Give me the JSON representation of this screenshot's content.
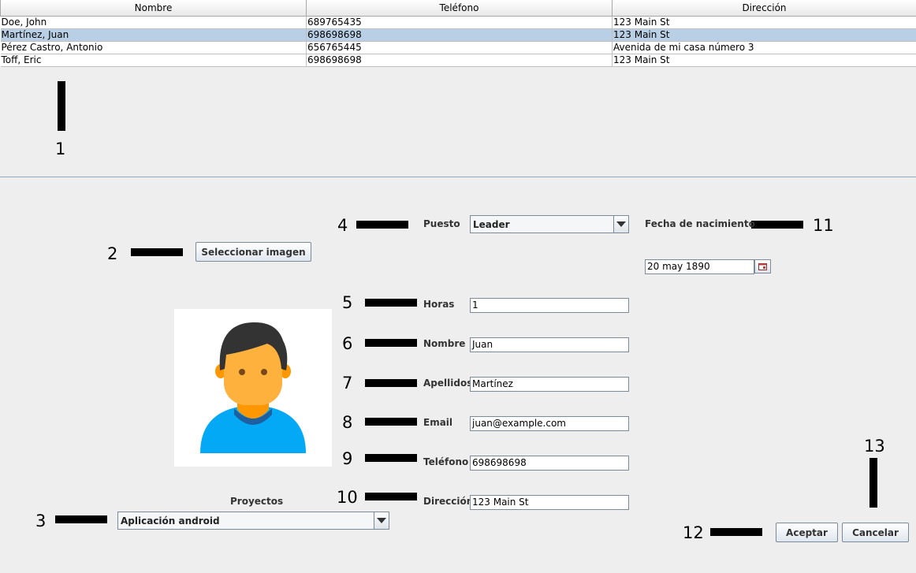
{
  "table": {
    "columns": [
      "Nombre",
      "Teléfono",
      "Dirección"
    ],
    "rows": [
      [
        "Doe, John",
        "689765435",
        "123 Main St"
      ],
      [
        "Martínez, Juan",
        "698698698",
        "123 Main St"
      ],
      [
        "Pérez Castro, Antonio",
        "656765445",
        "Avenida de mi casa número 3"
      ],
      [
        "Toff, Eric",
        "698698698",
        "123 Main St"
      ]
    ],
    "selected_row": 1
  },
  "callouts": [
    "1",
    "2",
    "3",
    "4",
    "5",
    "6",
    "7",
    "8",
    "9",
    "10",
    "11",
    "12",
    "13"
  ],
  "form": {
    "select_image_label": "Seleccionar imagen",
    "puesto_label": "Puesto",
    "puesto_value": "Leader",
    "fecha_label": "Fecha de nacimiento",
    "fecha_value": "20 may 1890",
    "horas_label": "Horas",
    "horas_value": "1",
    "nombre_label": "Nombre",
    "nombre_value": "Juan",
    "apellidos_label": "Apellidos",
    "apellidos_value": "Martínez",
    "email_label": "Email",
    "email_value": "juan@example.com",
    "telefono_label": "Teléfono",
    "telefono_value": "698698698",
    "direccion_label": "Dirección",
    "direccion_value": "123 Main St",
    "proyectos_label": "Proyectos",
    "proyectos_value": "Aplicación android",
    "accept_label": "Aceptar",
    "cancel_label": "Cancelar"
  },
  "colors": {
    "selected_row": "#b8cfe5",
    "avatar_hair": "#333333",
    "avatar_skin": "#ffb13d",
    "avatar_neck": "#ff9800",
    "avatar_shirt": "#03a9f4",
    "avatar_collar": "#1e5fa0"
  },
  "icons": [
    "calendar-icon",
    "chevron-down-icon"
  ]
}
